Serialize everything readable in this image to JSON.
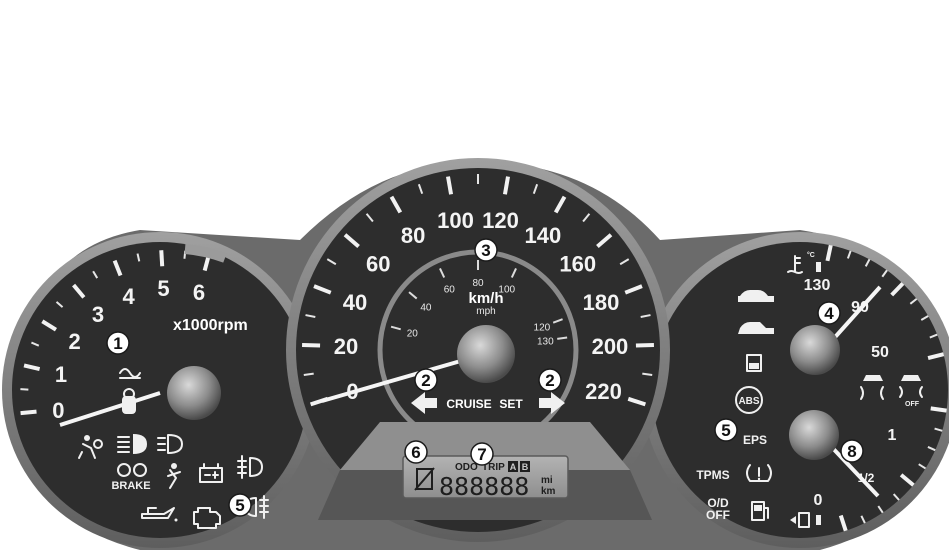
{
  "tachometer": {
    "unit_label": "x1000rpm",
    "scale": [
      "0",
      "1",
      "2",
      "3",
      "4",
      "5",
      "6"
    ],
    "callout": "1"
  },
  "speedometer": {
    "kmh_scale": [
      "0",
      "20",
      "40",
      "60",
      "80",
      "100",
      "120",
      "140",
      "160",
      "180",
      "200",
      "220"
    ],
    "mph_scale": [
      "20",
      "40",
      "60",
      "80",
      "100",
      "120",
      "130"
    ],
    "unit_kmh": "km/h",
    "unit_mph": "mph",
    "cruise_label": "CRUISE",
    "set_label": "SET",
    "callout_main": "3",
    "callout_turn": "2"
  },
  "lcd": {
    "odo_label": "ODO",
    "trip_label": "TRIP",
    "trip_a": "A",
    "trip_b": "B",
    "digits": "888888",
    "unit_mi": "mi",
    "unit_km": "km",
    "callout_left": "6",
    "callout_right": "7"
  },
  "right_cluster": {
    "temp_high": "130",
    "temp_mid": "90",
    "temp_low": "50",
    "fuel_full": "1",
    "fuel_half": "1/2",
    "fuel_empty": "0",
    "abs_label": "ABS",
    "eps_label": "EPS",
    "tpms_label": "TPMS",
    "od_off_line1": "O/D",
    "od_off_line2": "OFF",
    "esc_off_label": "OFF",
    "temp_unit": "°C",
    "callout_temp": "4",
    "callout_fuel": "8",
    "callout_warn": "5"
  },
  "left_warnings": {
    "brake_label": "BRAKE",
    "callout_warn": "5"
  },
  "icons": {
    "tach": [
      "glow-plug-icon",
      "immobilizer-key-icon",
      "airbag-icon",
      "high-beam-icon",
      "position-lamp-icon",
      "parking-brake-icon",
      "seatbelt-icon",
      "battery-icon",
      "front-fog-icon",
      "oil-pressure-icon",
      "engine-check-icon",
      "rear-fog-icon"
    ],
    "right": [
      "door-open-icon",
      "trunk-open-icon",
      "hood-open-icon",
      "abs-icon",
      "esc-icon",
      "esc-off-icon",
      "tpms-icon",
      "fuel-low-icon",
      "coolant-temp-icon"
    ]
  },
  "colors": {
    "dial_face": "#2d2d2d",
    "bezel": "#7a7a7a",
    "needle": "#f5f5f5",
    "lcd_bg": "#9a9a9a"
  }
}
